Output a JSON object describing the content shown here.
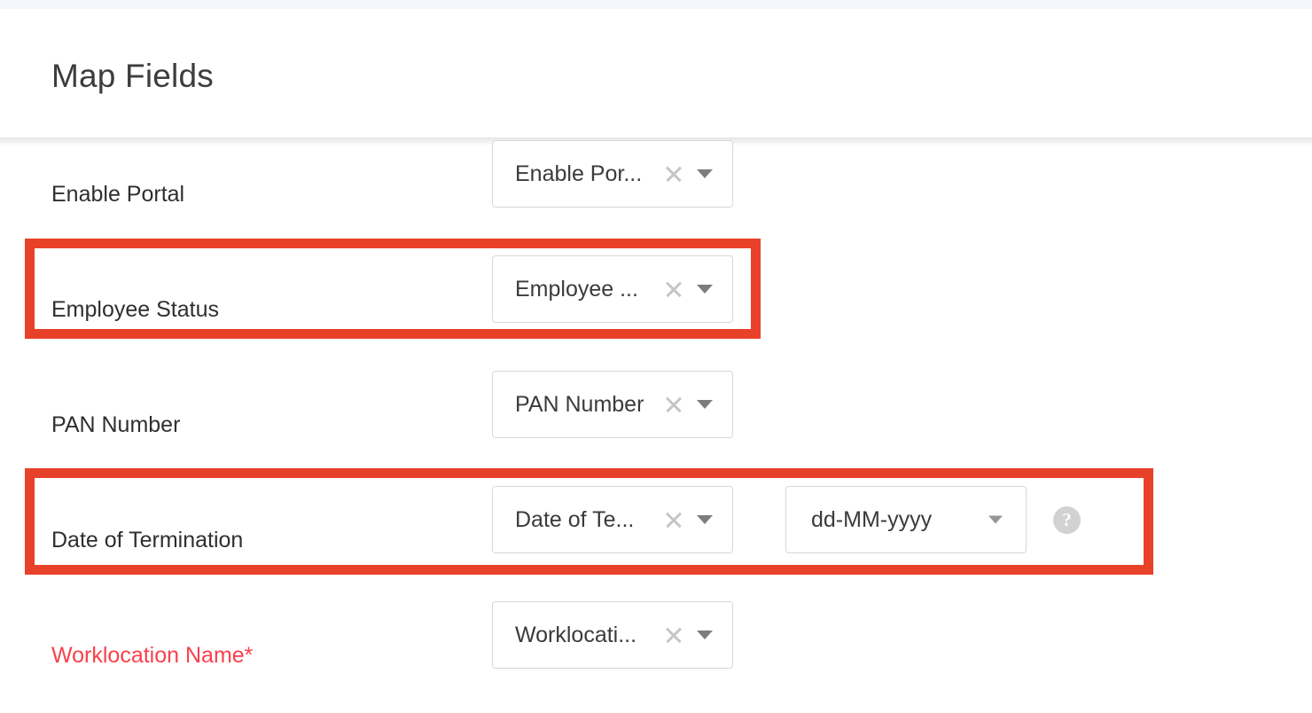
{
  "header": {
    "title": "Map Fields"
  },
  "colors": {
    "highlight": "#e8412a",
    "required_label": "#f8414b",
    "label": "#2f2f2f",
    "border": "#d8d8d8",
    "top_strip": "#f4f7fc"
  },
  "icons": {
    "clear": "clear-icon",
    "caret": "chevron-down-icon",
    "help": "?"
  },
  "rows": [
    {
      "label": "Enable Portal",
      "required": false,
      "highlighted": false,
      "field": {
        "value": "Enable Por...",
        "has_clear": true,
        "has_caret": true
      },
      "date_format": null,
      "help": false
    },
    {
      "label": "Employee Status",
      "required": false,
      "highlighted": true,
      "field": {
        "value": "Employee ...",
        "has_clear": true,
        "has_caret": true
      },
      "date_format": null,
      "help": false
    },
    {
      "label": "PAN Number",
      "required": false,
      "highlighted": false,
      "field": {
        "value": "PAN Number",
        "has_clear": true,
        "has_caret": true
      },
      "date_format": null,
      "help": false
    },
    {
      "label": "Date of Termination",
      "required": false,
      "highlighted": true,
      "field": {
        "value": "Date of Te...",
        "has_clear": true,
        "has_caret": true
      },
      "date_format": {
        "value": "dd-MM-yyyy"
      },
      "help": true
    },
    {
      "label": "Worklocation Name*",
      "required": true,
      "highlighted": false,
      "field": {
        "value": "Worklocati...",
        "has_clear": true,
        "has_caret": true
      },
      "date_format": null,
      "help": false
    }
  ]
}
